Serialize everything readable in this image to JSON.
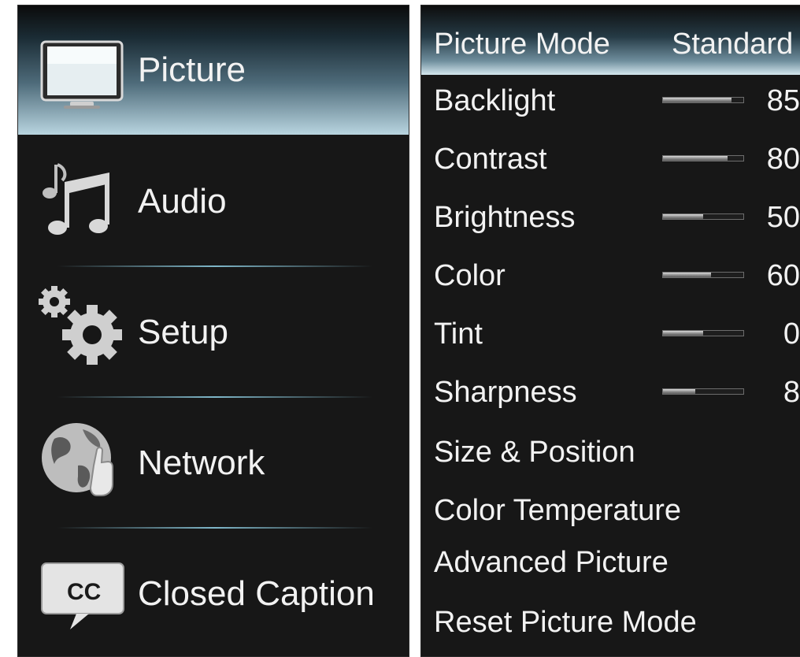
{
  "menu": {
    "items": [
      {
        "label": "Picture",
        "icon": "tv-icon"
      },
      {
        "label": "Audio",
        "icon": "music-note-icon"
      },
      {
        "label": "Setup",
        "icon": "gears-icon"
      },
      {
        "label": "Network",
        "icon": "globe-hand-icon"
      },
      {
        "label": "Closed Caption",
        "icon": "cc-icon"
      }
    ],
    "selected": "Picture"
  },
  "settings": {
    "picture_mode": {
      "label": "Picture Mode",
      "value": "Standard"
    },
    "sliders": [
      {
        "label": "Backlight",
        "value": "85",
        "level": 0.85
      },
      {
        "label": "Contrast",
        "value": "80",
        "level": 0.8
      },
      {
        "label": "Brightness",
        "value": "50",
        "level": 0.5
      },
      {
        "label": "Color",
        "value": "60",
        "level": 0.6
      },
      {
        "label": "Tint",
        "value": "0",
        "level": 0.5
      },
      {
        "label": "Sharpness",
        "value": "8",
        "level": 0.4
      }
    ],
    "links": [
      {
        "label": "Size & Position"
      },
      {
        "label": "Color Temperature"
      },
      {
        "label": "Advanced Picture"
      },
      {
        "label": "Reset Picture Mode"
      }
    ]
  },
  "colors": {
    "background": "#171717",
    "text": "#f2f2f2",
    "selection_highlight": "#b9d5e0",
    "divider": "#7fb7c9"
  }
}
